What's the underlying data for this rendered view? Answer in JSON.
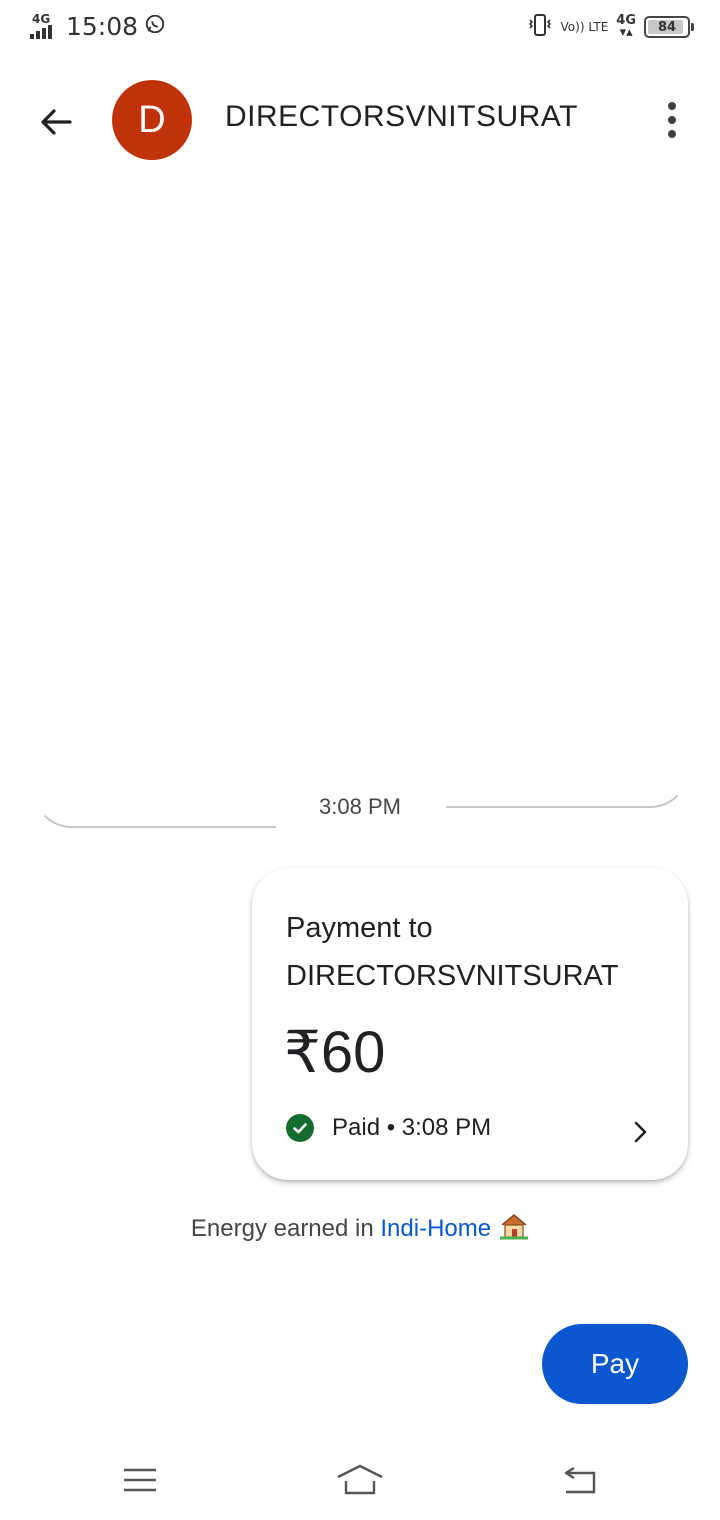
{
  "status_bar": {
    "network_left": "4G",
    "time": "15:08",
    "volte": "Vo)) LTE",
    "network_right": "4G",
    "battery": "84"
  },
  "header": {
    "avatar_letter": "D",
    "title": "DIRECTORSVNITSURAT",
    "avatar_color": "#c0330a"
  },
  "conversation": {
    "timestamp": "3:08 PM",
    "payment_card": {
      "title": "Payment to DIRECTORSVNITSURAT",
      "amount": "₹60",
      "status": "Paid • 3:08 PM"
    },
    "energy": {
      "prefix": "Energy earned in",
      "link": "Indi-Home",
      "icon": "house-emoji-icon"
    }
  },
  "actions": {
    "pay_label": "Pay",
    "pay_color": "#0b57d0"
  },
  "nav_bar": {
    "items": [
      "menu-icon",
      "home-icon",
      "back-icon"
    ]
  }
}
